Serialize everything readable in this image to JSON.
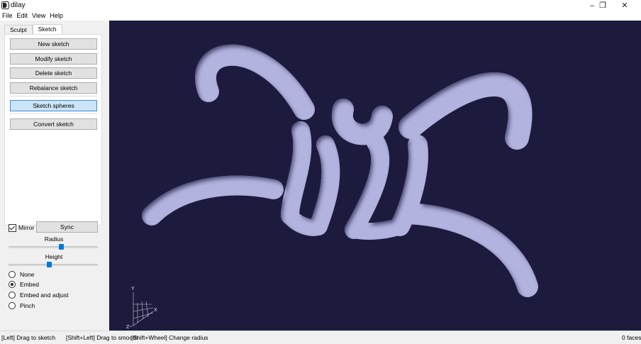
{
  "window": {
    "title": "dilay",
    "minimize_glyph": "–",
    "restore_glyph": "❐",
    "close_glyph": "✕"
  },
  "menu": [
    "File",
    "Edit",
    "View",
    "Help"
  ],
  "tabs": [
    {
      "label": "Sculpt",
      "active": false
    },
    {
      "label": "Sketch",
      "active": true
    }
  ],
  "sketch_buttons": {
    "new": "New sketch",
    "modify": "Modify sketch",
    "delete": "Delete sketch",
    "rebalance": "Rebalance sketch",
    "sketch_spheres": "Sketch spheres",
    "convert": "Convert sketch"
  },
  "sketch_spheres_checked": true,
  "options": {
    "mirror_label": "Mirror",
    "mirror_checked": true,
    "sync_label": "Sync",
    "radius_label": "Radius",
    "radius_level": 0.6,
    "height_label": "Height",
    "height_level": 0.45,
    "modes": [
      "None",
      "Embed",
      "Embed and adjust",
      "Pinch"
    ],
    "selected_mode": "Embed"
  },
  "axes": {
    "y": "Y",
    "x": "X",
    "z": "Z"
  },
  "viewport_colors": {
    "background": "#1c1b3d",
    "tube": "#b3b3e0"
  },
  "status": {
    "left_drag": "[Left] Drag to sketch",
    "shift_left": "[Shift+Left] Drag to smooth",
    "shift_wheel": "[Shift+Wheel] Change radius",
    "faces": "0 faces"
  }
}
